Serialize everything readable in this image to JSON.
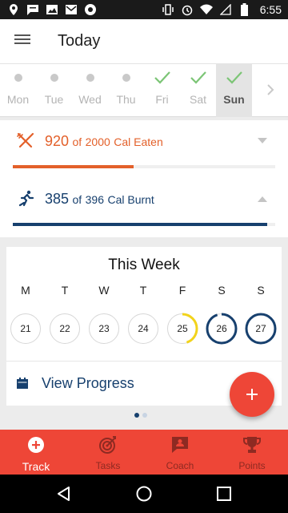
{
  "status_bar": {
    "time": "6:55",
    "left_icons": [
      "location-pin-icon",
      "chat-bubble-icon",
      "image-icon",
      "mail-icon",
      "app-icon"
    ],
    "right_icons": [
      "vibrate-icon",
      "alarm-icon",
      "wifi-icon",
      "signal-icon",
      "battery-icon"
    ]
  },
  "header": {
    "title": "Today",
    "menu_icon": "hamburger-menu-icon"
  },
  "day_strip": {
    "days": [
      {
        "label": "Mon",
        "status": "dot"
      },
      {
        "label": "Tue",
        "status": "dot"
      },
      {
        "label": "Wed",
        "status": "dot"
      },
      {
        "label": "Thu",
        "status": "dot"
      },
      {
        "label": "Fri",
        "status": "check"
      },
      {
        "label": "Sat",
        "status": "check"
      },
      {
        "label": "Sun",
        "status": "check",
        "selected": true
      }
    ],
    "colors": {
      "check": "#7cc576",
      "dot": "#c9c9c9"
    }
  },
  "calories": {
    "eaten": {
      "value": "920",
      "of": "of",
      "goal": "2000",
      "label": "Cal Eaten",
      "progress": 0.46,
      "color": "#e3602a",
      "icon": "fork-knife-icon"
    },
    "burnt": {
      "value": "385",
      "of": "of",
      "goal": "396",
      "label": "Cal Burnt",
      "progress": 0.97,
      "color": "#17406e",
      "icon": "running-person-icon"
    }
  },
  "week": {
    "title": "This Week",
    "days": [
      {
        "letter": "M",
        "date": "21",
        "ring": "none"
      },
      {
        "letter": "T",
        "date": "22",
        "ring": "none"
      },
      {
        "letter": "W",
        "date": "23",
        "ring": "none"
      },
      {
        "letter": "T",
        "date": "24",
        "ring": "none"
      },
      {
        "letter": "F",
        "date": "25",
        "ring": "partial",
        "progress": 0.45
      },
      {
        "letter": "S",
        "date": "26",
        "ring": "nearly-full",
        "progress": 0.95
      },
      {
        "letter": "S",
        "date": "27",
        "ring": "full",
        "progress": 1.0
      }
    ],
    "colors": {
      "partial": "#f2d31b",
      "complete": "#17406e"
    },
    "view_progress": {
      "label": "View Progress",
      "icon": "calendar-icon"
    }
  },
  "fab": {
    "icon": "plus-icon"
  },
  "pager": {
    "count": 2,
    "active": 0
  },
  "bottom_nav": {
    "items": [
      {
        "label": "Track",
        "icon": "plus-circle-icon",
        "active": true
      },
      {
        "label": "Tasks",
        "icon": "target-icon",
        "active": false
      },
      {
        "label": "Coach",
        "icon": "chat-person-icon",
        "active": false
      },
      {
        "label": "Points",
        "icon": "trophy-icon",
        "active": false
      }
    ],
    "color": "#ee4637"
  },
  "system_nav": {
    "buttons": [
      "back-icon",
      "home-icon",
      "recents-icon"
    ]
  }
}
